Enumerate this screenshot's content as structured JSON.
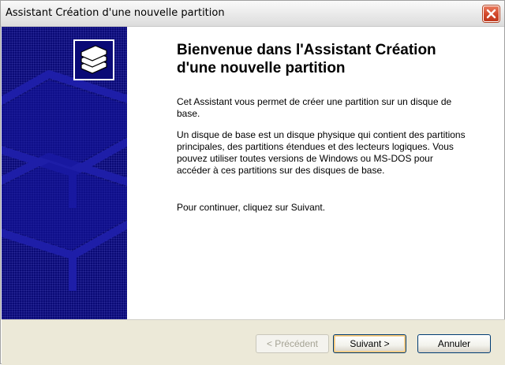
{
  "window": {
    "title": "Assistant Création d'une nouvelle partition"
  },
  "heading": "Bienvenue dans l'Assistant Création d'une nouvelle partition",
  "paragraphs": [
    "Cet Assistant vous permet de créer une partition sur un disque de base.",
    "Un disque de base est un disque physique qui contient des partitions principales, des partitions étendues et des lecteurs logiques. Vous pouvez utiliser toutes versions de Windows ou MS-DOS pour accéder à ces partitions sur des disques de base.",
    "Pour continuer, cliquez sur Suivant."
  ],
  "buttons": {
    "back": "< Précédent",
    "next": "Suivant >",
    "cancel": "Annuler"
  },
  "icons": {
    "close": "close-icon",
    "wizard": "stacked-disks-icon"
  },
  "colors": {
    "side_panel": "#0a0a76",
    "footer": "#ece9d8",
    "close_button": "#d2472a"
  }
}
